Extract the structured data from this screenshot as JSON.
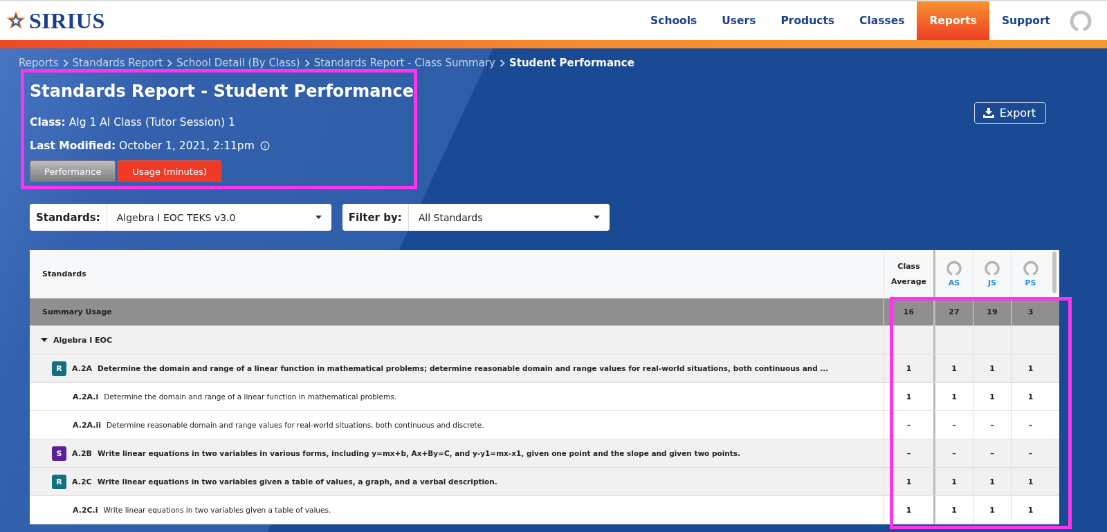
{
  "nav": {
    "logo": "SIRIUS",
    "items": [
      {
        "label": "Schools",
        "selected": false
      },
      {
        "label": "Users",
        "selected": false
      },
      {
        "label": "Products",
        "selected": false
      },
      {
        "label": "Classes",
        "selected": false
      },
      {
        "label": "Reports",
        "selected": true
      },
      {
        "label": "Support",
        "selected": false
      }
    ]
  },
  "breadcrumb": [
    "Reports",
    "Standards Report",
    "School Detail (By Class)",
    "Standards Report - Class Summary",
    "Student Performance"
  ],
  "title": "Standards Report - Student Performance",
  "class_info": {
    "label": "Class:",
    "value": "Alg 1 AI Class (Tutor Session) 1"
  },
  "last_modified": {
    "label": "Last Modified:",
    "value": "October 1, 2021, 2:11pm"
  },
  "tabs": [
    {
      "label": "Performance",
      "selected": false
    },
    {
      "label": "Usage (minutes)",
      "selected": true
    }
  ],
  "export_button": "Export",
  "filters": [
    {
      "label": "Standards:",
      "value": "Algebra I EOC TEKS v3.0"
    },
    {
      "label": "Filter by:",
      "value": "All Standards"
    }
  ],
  "table": {
    "columns": {
      "standards": "Standards",
      "average": "Class Average",
      "students": [
        "AS",
        "JS",
        "PS"
      ]
    },
    "summary": {
      "label": "Summary Usage",
      "values": [
        "16",
        "27",
        "19",
        "3"
      ]
    },
    "groups": [
      {
        "label": "Algebra I EOC",
        "expanded": true,
        "children": [
          {
            "badge": "R",
            "color": "#14707e",
            "code": "A.2A",
            "text": "Determine the domain and range of a linear function in mathematical problems; determine reasonable domain and range values for real-world situations, both continuous and ...",
            "values": [
              "1",
              "1",
              "1",
              "1"
            ],
            "children": [
              {
                "code": "A.2A.i",
                "text": "Determine the domain and range of a linear function in mathematical problems.",
                "values": [
                  "1",
                  "1",
                  "1",
                  "1"
                ]
              },
              {
                "code": "A.2A.ii",
                "text": "Determine reasonable domain and range values for real-world situations, both continuous and discrete.",
                "values": [
                  "–",
                  "–",
                  "–",
                  "–"
                ]
              }
            ]
          },
          {
            "badge": "S",
            "color": "#5b2098",
            "code": "A.2B",
            "text": "Write linear equations in two variables in various forms, including y=mx+b, Ax+By=C, and y-y1=mx-x1, given one point and the slope and given two points.",
            "values": [
              "–",
              "–",
              "–",
              "–"
            ]
          },
          {
            "badge": "R",
            "color": "#14707e",
            "code": "A.2C",
            "text": "Write linear equations in two variables given a table of values, a graph, and a verbal description.",
            "values": [
              "1",
              "1",
              "1",
              "1"
            ],
            "children": [
              {
                "code": "A.2C.i",
                "text": "Write linear equations in two variables given a table of values.",
                "values": [
                  "1",
                  "1",
                  "1",
                  "1"
                ]
              }
            ]
          }
        ]
      }
    ]
  }
}
